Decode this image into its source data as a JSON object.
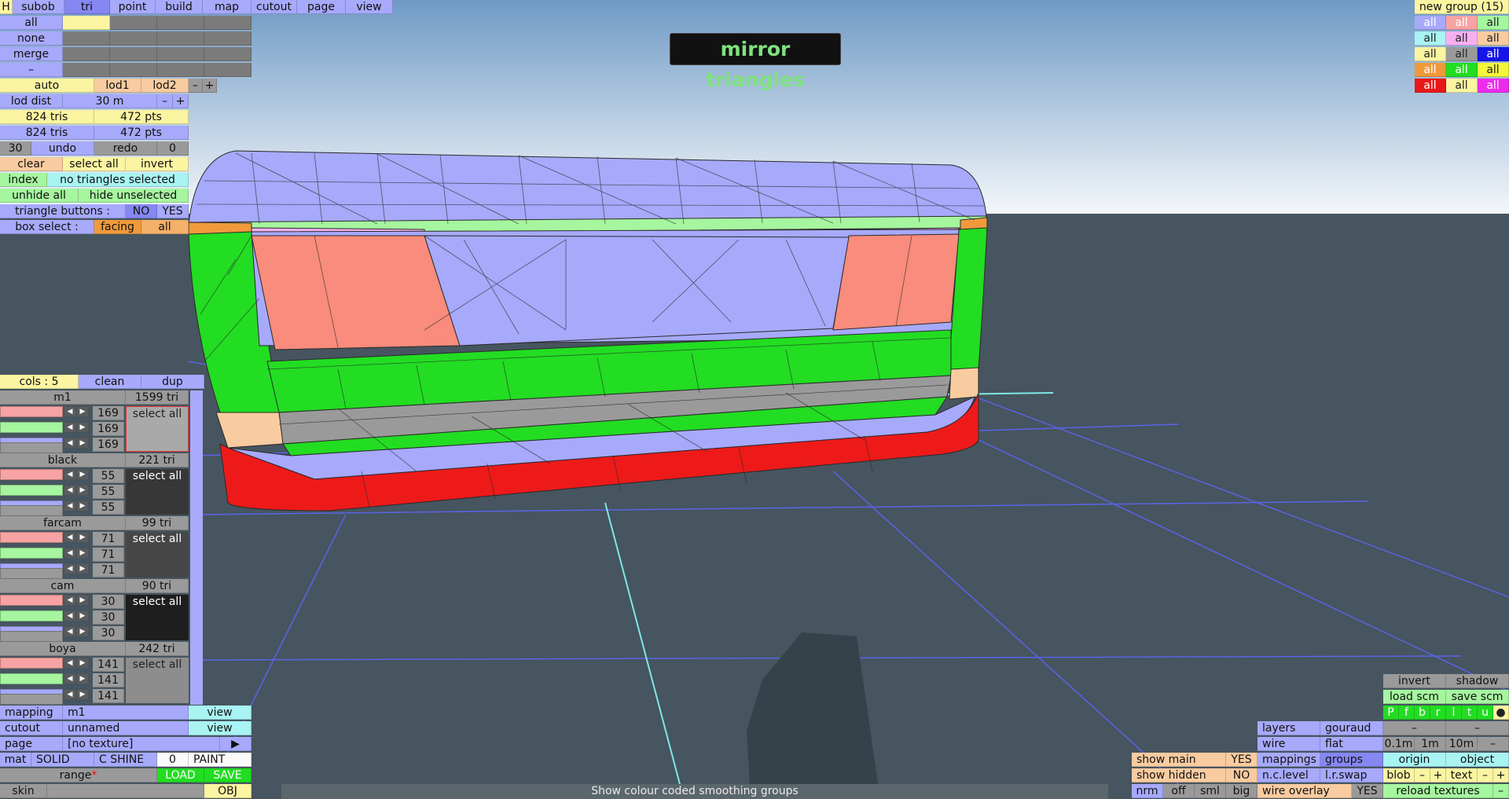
{
  "viewport": {
    "label": "3D viewport — mirror triangles"
  },
  "top_tabs": [
    "H",
    "subob",
    "tri",
    "point",
    "build",
    "map",
    "cutout",
    "page",
    "view"
  ],
  "left_rows": {
    "all": "all",
    "none": "none",
    "merge": "merge",
    "dash": "–"
  },
  "lod": {
    "auto": "auto",
    "lod1": "lod1",
    "lod2": "lod2",
    "minus": "–",
    "plus": "+"
  },
  "lod_dist": {
    "label": "lod dist",
    "value": "30 m",
    "minus": "–",
    "plus": "+"
  },
  "stats": {
    "tris1": "824 tris",
    "pts1": "472 pts",
    "tris2": "824 tris",
    "pts2": "472 pts"
  },
  "undo_row": {
    "count": "30",
    "undo": "undo",
    "redo": "redo",
    "redo_count": "0"
  },
  "sel_row": {
    "clear": "clear",
    "select_all": "select all",
    "invert": "invert"
  },
  "index_row": {
    "index": "index",
    "status": "no triangles selected"
  },
  "hide_row": {
    "unhide_all": "unhide all",
    "hide_unselected": "hide unselected"
  },
  "tri_buttons": {
    "label": "triangle buttons :",
    "no": "NO",
    "yes": "YES"
  },
  "box_select": {
    "label": "box select :",
    "facing": "facing",
    "all": "all"
  },
  "message": "mirror triangles",
  "cols_row": {
    "cols": "cols : 5",
    "clean": "clean",
    "dup": "dup"
  },
  "materials": [
    {
      "name": "m1",
      "tri": "1599 tri",
      "r": "169",
      "g": "169",
      "b": "169",
      "select": "select all",
      "swatch": "#a9a9a9"
    },
    {
      "name": "black",
      "tri": "221 tri",
      "r": "55",
      "g": "55",
      "b": "55",
      "select": "select all",
      "swatch": "#373737"
    },
    {
      "name": "farcam",
      "tri": "99 tri",
      "r": "71",
      "g": "71",
      "b": "71",
      "select": "select all",
      "swatch": "#474747"
    },
    {
      "name": "cam",
      "tri": "90 tri",
      "r": "30",
      "g": "30",
      "b": "30",
      "select": "select all",
      "swatch": "#1e1e1e"
    },
    {
      "name": "boya",
      "tri": "242 tri",
      "r": "141",
      "g": "141",
      "b": "141",
      "select": "select all",
      "swatch": "#8d8d8d"
    }
  ],
  "bottom_left": {
    "mapping_label": "mapping",
    "mapping_value": "m1",
    "view": "view",
    "cutout_label": "cutout",
    "cutout_value": "unnamed",
    "view2": "view",
    "page_label": "page",
    "page_value": "[no texture]",
    "page_arrow": "▶",
    "mat": "mat",
    "solid": "SOLID",
    "cshine": "C SHINE",
    "zero": "0",
    "paint": "PAINT",
    "range": "range",
    "range_star": "*",
    "load": "LOAD",
    "save": "SAVE",
    "skin": "skin",
    "obj": "OBJ"
  },
  "groups": {
    "title": "new group (15)",
    "cells": [
      {
        "t": "all",
        "bg": "#a7a9fb",
        "fg": "#fff"
      },
      {
        "t": "all",
        "bg": "#f7a3a3",
        "fg": "#fff"
      },
      {
        "t": "all",
        "bg": "#a6f59f",
        "fg": "#222"
      },
      {
        "t": "all",
        "bg": "#a9f3f3",
        "fg": "#222"
      },
      {
        "t": "all",
        "bg": "#f6b0f2",
        "fg": "#222"
      },
      {
        "t": "all",
        "bg": "#f9cba0",
        "fg": "#222"
      },
      {
        "t": "all",
        "bg": "#fbf4a1",
        "fg": "#222"
      },
      {
        "t": "all",
        "bg": "#9a9a9a",
        "fg": "#222"
      },
      {
        "t": "all",
        "bg": "#1515e8",
        "fg": "#fff"
      },
      {
        "t": "all",
        "bg": "#f09a3c",
        "fg": "#fff"
      },
      {
        "t": "all",
        "bg": "#22dd22",
        "fg": "#fff"
      },
      {
        "t": "all",
        "bg": "#f5f53c",
        "fg": "#222"
      },
      {
        "t": "all",
        "bg": "#e81818",
        "fg": "#fff"
      },
      {
        "t": "all",
        "bg": "#fbf4a1",
        "fg": "#222"
      },
      {
        "t": "all",
        "bg": "#ec2cec",
        "fg": "#fff"
      }
    ]
  },
  "bottom_right": {
    "invert": "invert",
    "shadow": "shadow",
    "load_scm": "load scm",
    "save_scm": "save scm",
    "flags": [
      "P",
      "f",
      "b",
      "r",
      "l",
      "t",
      "u",
      "●"
    ],
    "dash1": "–",
    "dash2": "–",
    "layers": "layers",
    "gouraud": "gouraud",
    "wire": "wire",
    "flat": "flat",
    "d01": "0.1m",
    "d1": "1m",
    "d10": "10m",
    "dminus": "–",
    "show_main": "show main",
    "show_main_v": "YES",
    "mappings": "mappings",
    "groups": "groups",
    "origin": "origin",
    "object": "object",
    "show_hidden": "show hidden",
    "show_hidden_v": "NO",
    "nclevel": "n.c.level",
    "lrswap": "l.r.swap",
    "blob": "blob",
    "bminus": "–",
    "bplus": "+",
    "text": "text",
    "tminus": "–",
    "tplus": "+",
    "nrm": "nrm",
    "off": "off",
    "sml": "sml",
    "big": "big",
    "wire_overlay": "wire overlay",
    "wire_overlay_v": "YES",
    "reload": "reload textures",
    "rminus": "–"
  },
  "status": "Show colour coded smoothing groups"
}
